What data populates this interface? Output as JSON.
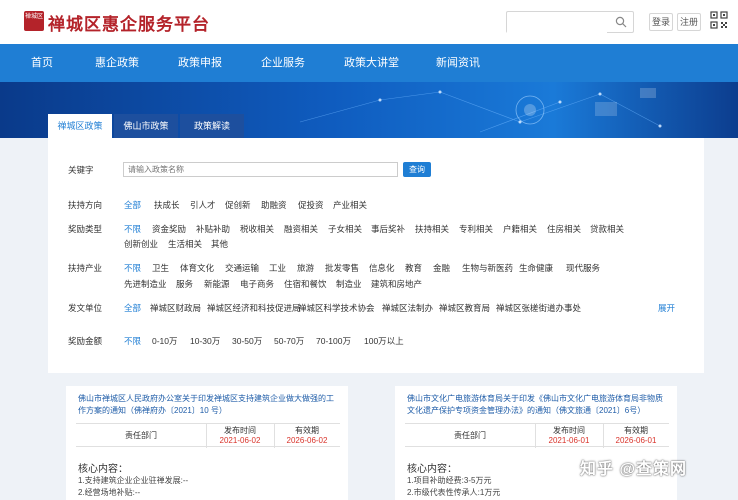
{
  "header": {
    "logo_text": "禅城区",
    "site_title": "禅城区惠企服务平台",
    "search_placeholder": "",
    "login_label": "登录",
    "register_label": "注册"
  },
  "nav": {
    "items": [
      "首页",
      "惠企政策",
      "政策申报",
      "企业服务",
      "政策大讲堂",
      "新闻资讯"
    ]
  },
  "tabs": [
    {
      "label": "禅城区政策",
      "active": true
    },
    {
      "label": "佛山市政策",
      "active": false
    },
    {
      "label": "政策解读",
      "active": false
    }
  ],
  "filters": {
    "keyword_label": "关键字",
    "keyword_placeholder": "请输入政策名称",
    "query_button": "查询",
    "support_direction": {
      "label": "扶持方向",
      "options": [
        "全部",
        "扶成长",
        "引人才",
        "促创新",
        "助融资",
        "促投资",
        "产业相关"
      ]
    },
    "reward_type": {
      "label": "奖励类型",
      "options_row1": [
        "不限",
        "资金奖励",
        "补贴补助",
        "税收相关",
        "融资相关",
        "子女相关",
        "事后奖补",
        "扶持相关",
        "专利相关",
        "户籍相关",
        "住房相关",
        "贷款相关"
      ],
      "options_row2": [
        "创新创业",
        "生活相关",
        "其他"
      ]
    },
    "industry": {
      "label": "扶持产业",
      "options_row1": [
        "不限",
        "卫生",
        "体育文化",
        "交通运输",
        "工业",
        "旅游",
        "批发零售",
        "信息化",
        "教育",
        "金融",
        "生物与新医药",
        "生命健康",
        "现代服务"
      ],
      "options_row2": [
        "先进制造业",
        "服务",
        "新能源",
        "电子商务",
        "住宿和餐饮",
        "制造业",
        "建筑和房地产"
      ]
    },
    "issuing_unit": {
      "label": "发文单位",
      "options": [
        "全部",
        "禅城区财政局",
        "禅城区经济和科技促进局",
        "禅城区科学技术协会",
        "禅城区法制办",
        "禅城区教育局",
        "禅城区张槎街道办事处"
      ],
      "expand_label": "展开"
    },
    "reward_amount": {
      "label": "奖励金额",
      "options": [
        "不限",
        "0-10万",
        "10-30万",
        "30-50万",
        "50-70万",
        "70-100万",
        "100万以上"
      ]
    }
  },
  "cards": [
    {
      "title": "佛山市禅城区人民政府办公室关于印发禅城区支持建筑企业做大做强的工作方案的通知（佛禅府办〔2021〕10 号）",
      "col_dept": "责任部门",
      "col_publish": "发布时间",
      "col_valid": "有效期",
      "publish_date": "2021-06-02",
      "valid_date": "2026-06-02",
      "core_title": "核心内容：",
      "lines": [
        "1.支持建筑企业企业驻禅发展:--",
        "2.经营场地补贴:--"
      ]
    },
    {
      "title": "佛山市文化广电旅游体育局关于印发《佛山市文化广电旅游体育局非物质文化遗产保护专项资金管理办法》的通知（佛文旅通〔2021〕6号）",
      "col_dept": "责任部门",
      "col_publish": "发布时间",
      "col_valid": "有效期",
      "publish_date": "2021-06-01",
      "valid_date": "2026-06-01",
      "core_title": "核心内容：",
      "lines": [
        "1.项目补助经费:3-5万元",
        "2.市级代表性传承人:1万元"
      ]
    }
  ],
  "watermark": "知乎 @查策网",
  "colors": {
    "brand_red": "#b4232a",
    "nav_blue": "#1f7ed4",
    "date_red": "#d9342b"
  }
}
